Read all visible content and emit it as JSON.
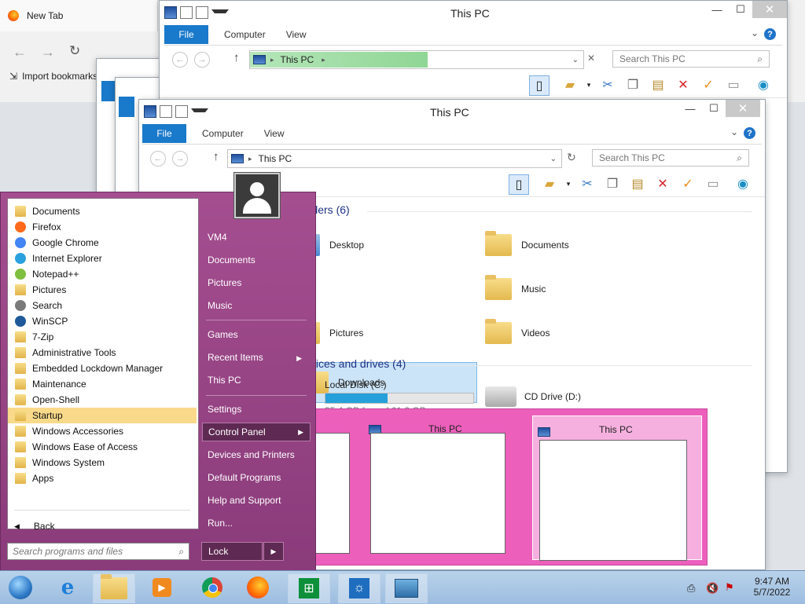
{
  "browser": {
    "tab_title": "New Tab",
    "import_label": "Import bookmarks"
  },
  "back_window": {
    "title": "This PC",
    "tabs": [
      "File",
      "Computer",
      "View"
    ],
    "address": "This PC",
    "search": "Search This PC"
  },
  "front_window": {
    "title": "This PC",
    "tabs": [
      "File",
      "Computer",
      "View"
    ],
    "address": "This PC",
    "search": "Search This PC",
    "folders_group": "Folders (6)",
    "folders": [
      "Desktop",
      "Documents",
      "Downloads",
      "Music",
      "Pictures",
      "Videos"
    ],
    "drives_group": "Devices and drives (4)",
    "drive_c": {
      "name": "Local Disk (C:)",
      "free": "35.4 GB free of 61.2 GB",
      "used_fraction": 0.42
    },
    "drive_d": "CD Drive (D:)"
  },
  "start_menu": {
    "programs": [
      {
        "label": "Documents",
        "icon": "folder"
      },
      {
        "label": "Firefox",
        "icon": "firefox"
      },
      {
        "label": "Google Chrome",
        "icon": "chrome"
      },
      {
        "label": "Internet Explorer",
        "icon": "ie"
      },
      {
        "label": "Notepad++",
        "icon": "notepad"
      },
      {
        "label": "Pictures",
        "icon": "folder"
      },
      {
        "label": "Search",
        "icon": "search"
      },
      {
        "label": "WinSCP",
        "icon": "winscp"
      },
      {
        "label": "7-Zip",
        "icon": "folder"
      },
      {
        "label": "Administrative Tools",
        "icon": "folder"
      },
      {
        "label": "Embedded Lockdown Manager",
        "icon": "folder"
      },
      {
        "label": "Maintenance",
        "icon": "folder"
      },
      {
        "label": "Open-Shell",
        "icon": "folder"
      },
      {
        "label": "Startup",
        "icon": "folder"
      },
      {
        "label": "Windows Accessories",
        "icon": "folder"
      },
      {
        "label": "Windows Ease of Access",
        "icon": "folder"
      },
      {
        "label": "Windows System",
        "icon": "folder"
      },
      {
        "label": "Apps",
        "icon": "folder"
      }
    ],
    "back": "Back",
    "search_placeholder": "Search programs and files",
    "right": {
      "user": "VM4",
      "documents": "Documents",
      "pictures": "Pictures",
      "music": "Music",
      "games": "Games",
      "recent": "Recent Items",
      "thispc": "This PC",
      "settings": "Settings",
      "control_panel": "Control Panel",
      "devices": "Devices and Printers",
      "default_programs": "Default Programs",
      "help": "Help and Support",
      "run": "Run..."
    },
    "lock": "Lock"
  },
  "taskbar": {
    "peek_titles": [
      "This PC",
      "This PC"
    ],
    "time": "9:47 AM",
    "date": "5/7/2022"
  }
}
